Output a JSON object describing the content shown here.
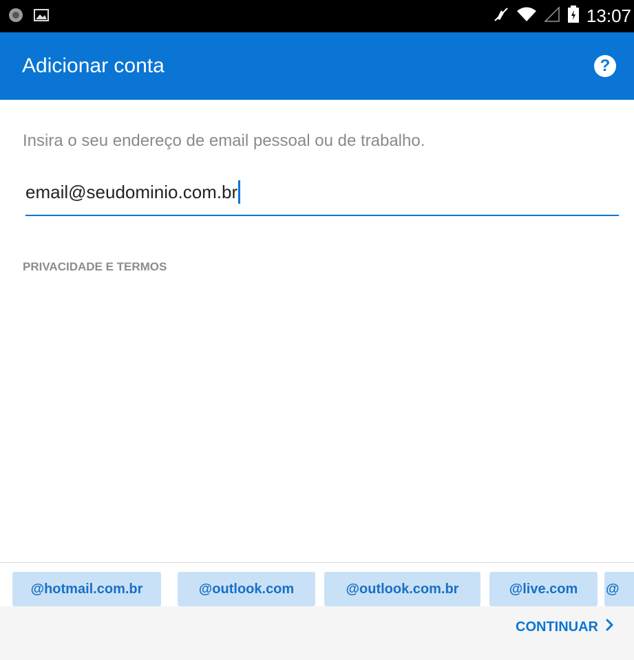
{
  "status_bar": {
    "time": "13:07",
    "icons": [
      "app-notification-icon",
      "image-notification-icon",
      "mute-icon",
      "wifi-icon",
      "signal-icon",
      "battery-icon"
    ]
  },
  "app_bar": {
    "title": "Adicionar conta",
    "help_icon": "question-icon",
    "help_glyph": "?"
  },
  "form": {
    "prompt": "Insira o seu endereço de email pessoal ou de trabalho.",
    "email_value": "email@seudominio.com.br"
  },
  "links": {
    "privacy": "PRIVACIDADE E TERMOS"
  },
  "domain_suggestions": [
    "@hotmail.com.br",
    "@outlook.com",
    "@outlook.com.br",
    "@live.com",
    "@"
  ],
  "footer": {
    "continue_label": "CONTINUAR",
    "continue_icon": "chevron-right-icon"
  },
  "colors": {
    "accent": "#0a75d4",
    "chip_background": "#c9e1f6",
    "footer_background": "#f5f5f5"
  }
}
